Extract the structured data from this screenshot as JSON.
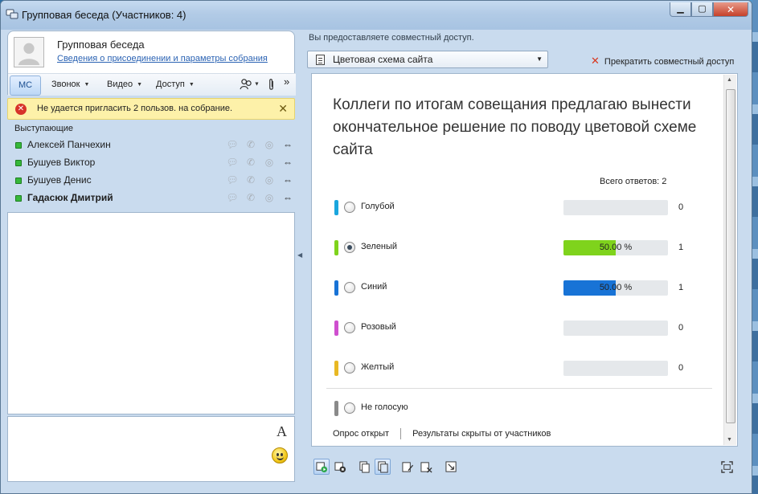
{
  "window": {
    "title": "Групповая беседа (Участников: 4)",
    "controls": {
      "minimize": "▁",
      "maximize": "▢",
      "close": "✕"
    }
  },
  "conversation": {
    "title": "Групповая беседа",
    "join_link": "Сведения о присоединении и параметры собрания",
    "avatar_icon": "person-silhouette-icon"
  },
  "toolbar": {
    "tab_mc": "МС",
    "call": "Звонок",
    "video": "Видео",
    "access": "Доступ",
    "overflow": "»"
  },
  "alert": {
    "message": "Не удается пригласить 2 пользов. на собрание.",
    "close": "✕"
  },
  "participants": {
    "section_label": "Выступающие",
    "items": [
      {
        "name": "Алексей Панчехин"
      },
      {
        "name": "Бушуев Виктор"
      },
      {
        "name": "Бушуев Денис"
      },
      {
        "name": "Гадасюк Дмитрий"
      }
    ]
  },
  "compose": {
    "font_button": "A"
  },
  "sharing": {
    "status_label": "Вы предоставляете совместный доступ.",
    "dropdown_selected": "Цветовая схема сайта",
    "stop_sharing": "Прекратить совместный доступ"
  },
  "poll": {
    "question": "Коллеги по итогам совещания предлагаю вынести окончательное решение по поводу цветовой схеме сайта",
    "total_label": "Всего ответов: 2",
    "options": [
      {
        "label": "Голубой",
        "color": "#1aa6de",
        "fraction": 0.0,
        "percent_text": "",
        "count": "0",
        "selected": false
      },
      {
        "label": "Зеленый",
        "color": "#7fd31c",
        "fraction": 0.5,
        "percent_text": "50.00 %",
        "count": "1",
        "selected": true
      },
      {
        "label": "Синий",
        "color": "#1873d6",
        "fraction": 0.5,
        "percent_text": "50.00 %",
        "count": "1",
        "selected": false
      },
      {
        "label": "Розовый",
        "color": "#cf4fcf",
        "fraction": 0.0,
        "percent_text": "",
        "count": "0",
        "selected": false
      },
      {
        "label": "Желтый",
        "color": "#e8b824",
        "fraction": 0.0,
        "percent_text": "",
        "count": "0",
        "selected": false
      }
    ],
    "abstain": {
      "label": "Не голосую",
      "color": "#8a8a8a"
    },
    "status_open": "Опрос открыт",
    "status_hidden": "Результаты скрыты от участников"
  }
}
